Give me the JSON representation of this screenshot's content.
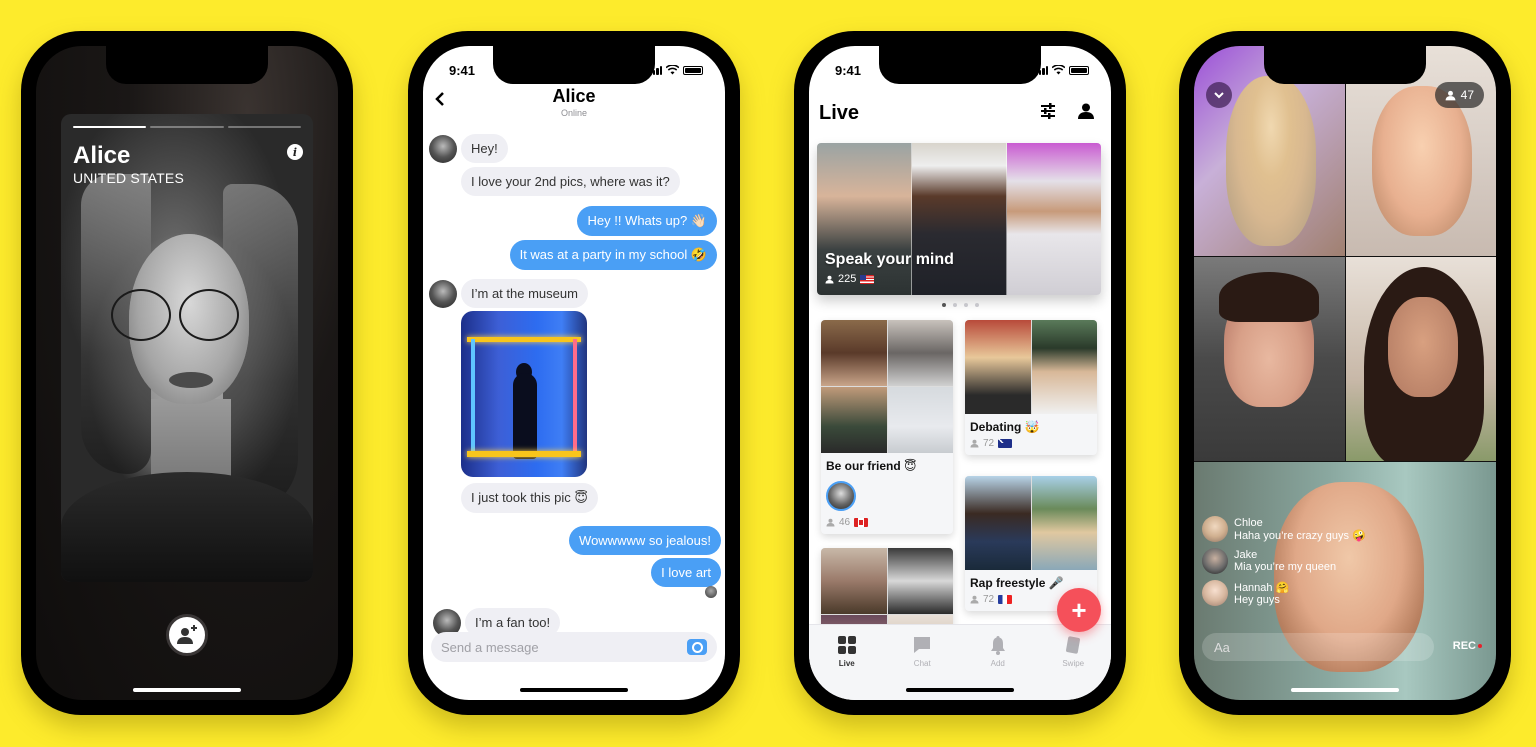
{
  "colors": {
    "background": "#fdeb2c",
    "outgoing_bubble": "#4a9ff5",
    "incoming_bubble": "#efeff4",
    "fab": "#f5505a",
    "rec_dot": "#e8212b"
  },
  "profile_screen": {
    "name": "Alice",
    "country": "UNITED STATES",
    "info_icon": "info-icon",
    "photo_progress": {
      "total": 3,
      "current": 1
    },
    "add_friend_icon": "add-person-icon"
  },
  "chat_screen": {
    "status_time": "9:41",
    "title": "Alice",
    "subtitle": "Online",
    "back_icon": "chevron-left-icon",
    "messages": [
      {
        "from": "them",
        "text": "Hey!"
      },
      {
        "from": "them",
        "text": "I love your 2nd pics, where was it?"
      },
      {
        "from": "me",
        "text": "Hey !! Whats up? 👋🏻"
      },
      {
        "from": "me",
        "text": "It was at a party in my school 🤣"
      },
      {
        "from": "them",
        "text": "I’m at the museum"
      },
      {
        "from": "them",
        "type": "image",
        "alt": "person silhouette in neon light installation"
      },
      {
        "from": "them",
        "text": "I just took this pic 😇"
      },
      {
        "from": "me",
        "text": "Wowwwww so jealous!"
      },
      {
        "from": "me",
        "text": "I love art"
      },
      {
        "from": "them",
        "text": "I’m a fan too!"
      }
    ],
    "input_placeholder": "Send a message",
    "camera_icon": "camera-icon"
  },
  "live_screen": {
    "status_time": "9:41",
    "title": "Live",
    "featured": {
      "title": "Speak your mind",
      "viewers": "225",
      "flag": "us"
    },
    "carousel": {
      "pages": 4,
      "current": 1
    },
    "rooms": [
      {
        "title": "Be our friend 😇",
        "viewers": "46",
        "flag": "ca"
      },
      {
        "title": "Debating 🤯",
        "viewers": "72",
        "flag": "au"
      },
      {
        "title": "Rap freestyle 🎤",
        "viewers": "72",
        "flag": "fr"
      }
    ],
    "fab_label": "+",
    "tabs": [
      {
        "label": "Live",
        "icon": "grid-icon",
        "active": true
      },
      {
        "label": "Chat",
        "icon": "chat-bubble-icon",
        "active": false
      },
      {
        "label": "Add",
        "icon": "bell-icon",
        "active": false
      },
      {
        "label": "Swipe",
        "icon": "card-icon",
        "active": false
      }
    ]
  },
  "video_room_screen": {
    "viewer_count": "47",
    "comments": [
      {
        "name": "Chloe",
        "text": "Haha you’re crazy guys 🤪"
      },
      {
        "name": "Jake",
        "text": "Mia you’re my queen"
      },
      {
        "name": "Hannah 🤗",
        "text": "Hey guys"
      }
    ],
    "input_placeholder": "Aa",
    "rec_label": "REC"
  }
}
